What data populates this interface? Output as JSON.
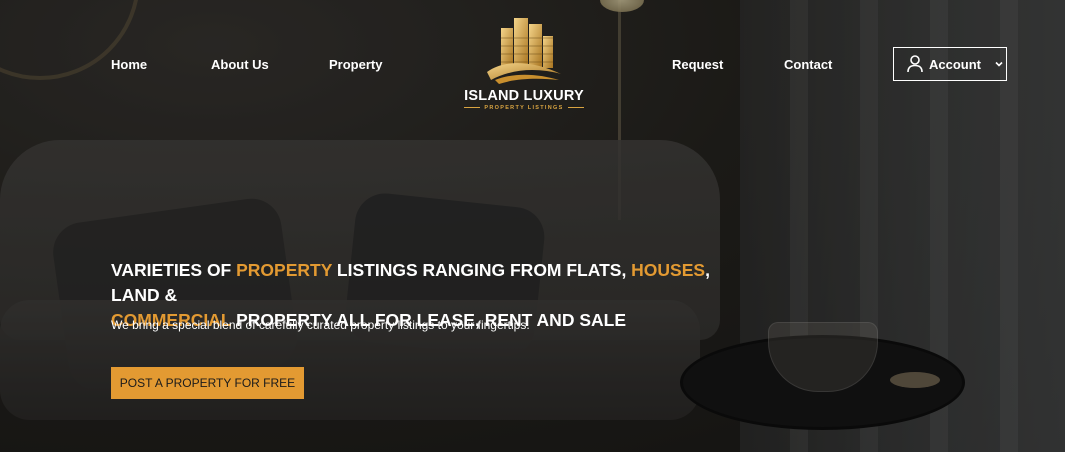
{
  "nav": {
    "left": [
      "Home",
      "About Us",
      "Property"
    ],
    "right": [
      "Request",
      "Contact"
    ],
    "account_label": "Account"
  },
  "logo": {
    "brand": "ISLAND LUXURY",
    "tagline": "PROPERTY LISTINGS",
    "icon": "gold-buildings-logo"
  },
  "hero": {
    "headline_parts": [
      "VARIETIES OF ",
      "PROPERTY",
      " LISTINGS RANGING FROM FLATS, ",
      "HOUSES",
      ", LAND & ",
      "COMMERCIAL",
      " PROPERTY ALL FOR LEASE, RENT AND SALE"
    ],
    "subtext": "We bring a special blend of carefully curated property listings to your fingertips.",
    "cta_label": "POST A PROPERTY FOR FREE"
  },
  "colors": {
    "accent": "#e39a32",
    "gold": "#d9a441",
    "text": "#ffffff"
  }
}
